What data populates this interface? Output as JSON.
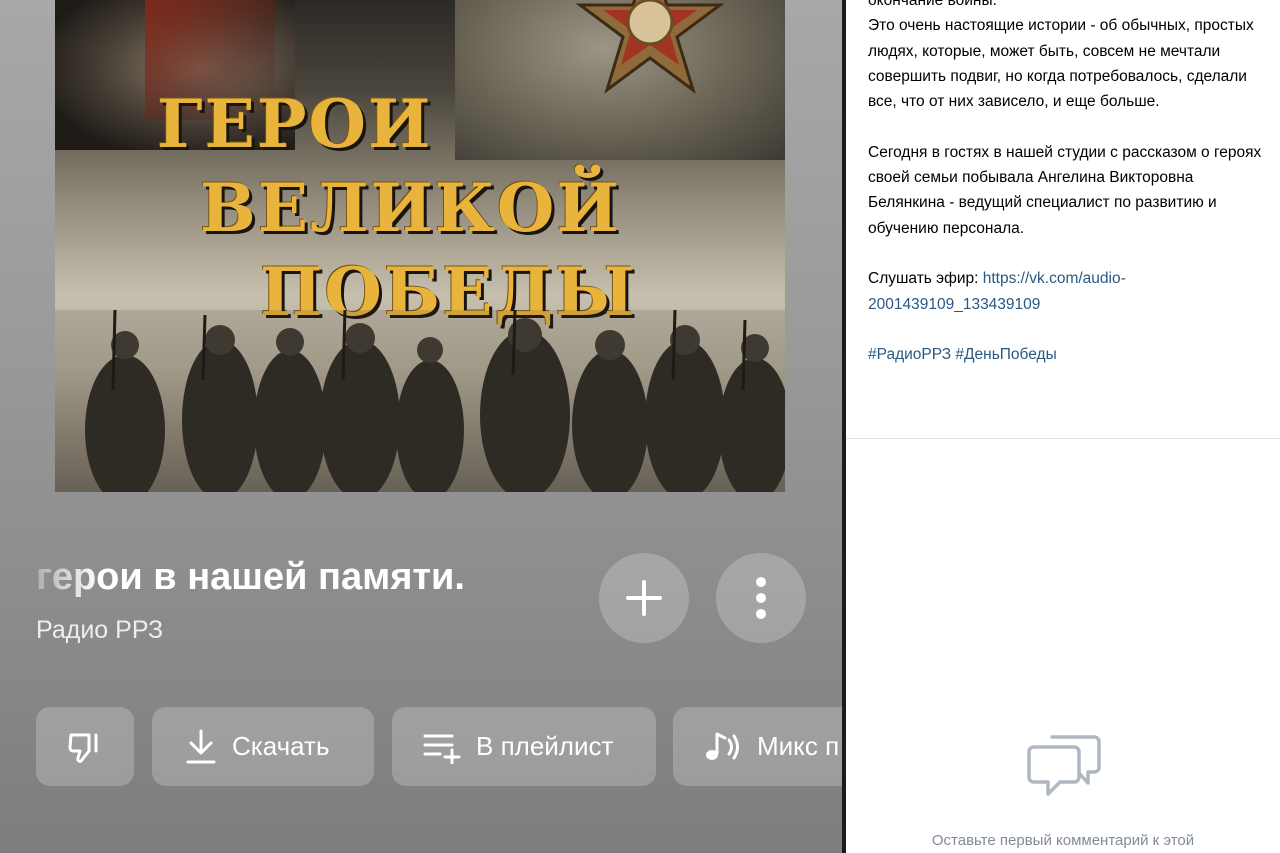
{
  "cover": {
    "title_lines": [
      "ГЕРОИ",
      "ВЕЛИКОЙ",
      "ПОБЕДЫ"
    ]
  },
  "player": {
    "track_title": "герои в нашей памяти.",
    "artist": "Радио РРЗ",
    "actions": {
      "download_label": "Скачать",
      "playlist_label": "В плейлист",
      "mix_label": "Микс п"
    }
  },
  "post": {
    "line0": "окончание войны.",
    "para1": "Это очень настоящие истории - об обычных, простых людях, которые, может быть, совсем не мечтали совершить подвиг, но когда потребовалось, сделали все, что от них зависело, и еще больше.",
    "para2": "Сегодня в гостях в нашей студии с рассказом о героях своей семьи побывала Ангелина Викторовна Белянкина - ведущий специалист по развитию и обучению персонала.",
    "listen_label": "Слушать эфир:",
    "listen_link": "https://vk.com/audio-2001439109_133439109",
    "hashtag1": "#РадиоРРЗ",
    "hashtag2": "#ДеньПобеды"
  },
  "comments": {
    "empty_note": "Оставьте первый комментарий к этой"
  },
  "icons": {
    "add": "plus-icon",
    "more": "more-vertical-icon",
    "dislike": "thumb-down-icon",
    "download": "download-icon",
    "playlist": "playlist-add-icon",
    "mix": "music-mix-icon",
    "comment": "comment-icon"
  },
  "colors": {
    "link": "#2a5885",
    "title_gold": "#e8b43c",
    "muted": "#818c99"
  }
}
